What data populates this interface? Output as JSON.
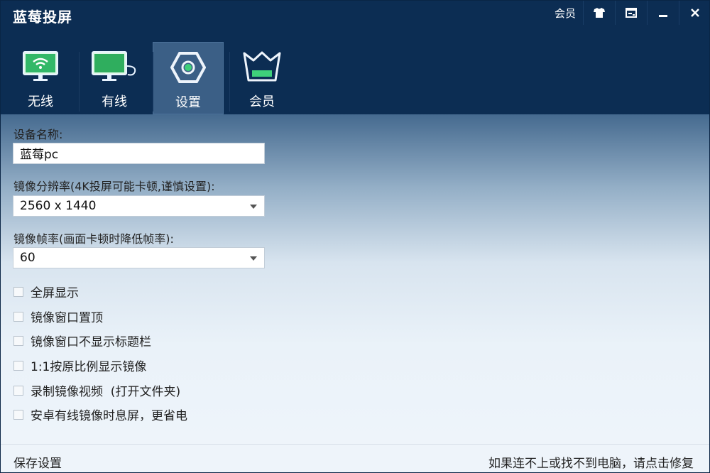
{
  "app": {
    "title": "蓝莓投屏",
    "controls": {
      "member_label": "会员"
    }
  },
  "tabs": [
    {
      "label": "无线",
      "icon": "wifi-monitor-icon",
      "active": false
    },
    {
      "label": "有线",
      "icon": "wired-monitor-icon",
      "active": false
    },
    {
      "label": "设置",
      "icon": "settings-hexagon-icon",
      "active": true
    },
    {
      "label": "会员",
      "icon": "crown-basket-icon",
      "active": false
    }
  ],
  "settings": {
    "device_name_label": "设备名称:",
    "device_name_value": "蓝莓pc",
    "resolution_label": "镜像分辨率(4K投屏可能卡顿,谨慎设置):",
    "resolution_value": "2560 x 1440",
    "framerate_label": "镜像帧率(画面卡顿时降低帧率):",
    "framerate_value": "60",
    "options": [
      {
        "label": "全屏显示",
        "checked": false
      },
      {
        "label": "镜像窗口置顶",
        "checked": false
      },
      {
        "label": "镜像窗口不显示标题栏",
        "checked": false
      },
      {
        "label": "1:1按原比例显示镜像",
        "checked": false
      },
      {
        "label": "录制镜像视频  (打开文件夹)",
        "checked": false
      },
      {
        "label": "安卓有线镜像时息屏，更省电",
        "checked": false
      }
    ]
  },
  "footer": {
    "save_label": "保存设置",
    "repair_label": "如果连不上或找不到电脑，请点击修复"
  },
  "colors": {
    "header_bg": "#0c2d53",
    "active_tab_bg": "#3b5f86",
    "accent_green": "#3fd07a"
  }
}
